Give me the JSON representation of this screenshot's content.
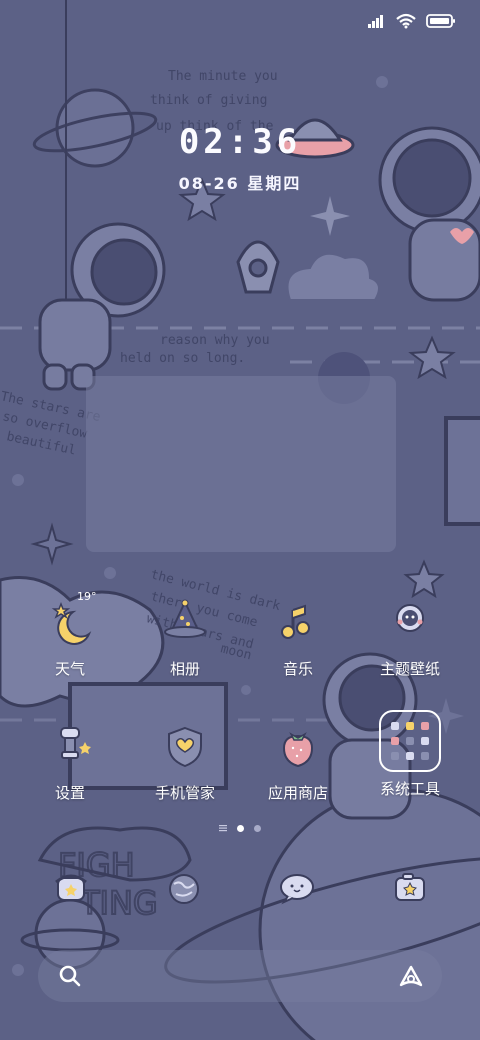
{
  "status_bar": {
    "icons": [
      "signal-icon",
      "wifi-icon",
      "battery-icon"
    ]
  },
  "clock": {
    "time": "02:36",
    "date": "08-26 星期四"
  },
  "wallpaper_text": {
    "line1": "The minute you",
    "line2": "think of giving",
    "line3": "up think of the",
    "line4": "reason why you",
    "line5": "held on so long.",
    "line6": "The stars are",
    "line7": "so overflow",
    "line8": "beautiful",
    "line9": "the world is dark",
    "line10": "there you come",
    "line11": "with stars and",
    "line12": "moon",
    "line13": "FIGH",
    "line14": "TING"
  },
  "apps": {
    "row1": [
      {
        "label": "天气",
        "icon": "weather-moon-icon",
        "temp": "19°"
      },
      {
        "label": "相册",
        "icon": "gallery-wizard-hat-icon"
      },
      {
        "label": "音乐",
        "icon": "music-moon-icon"
      },
      {
        "label": "主题壁纸",
        "icon": "themes-astronaut-icon"
      }
    ],
    "row2": [
      {
        "label": "设置",
        "icon": "settings-lamp-icon"
      },
      {
        "label": "手机管家",
        "icon": "security-shield-icon"
      },
      {
        "label": "应用商店",
        "icon": "app-store-strawberry-icon"
      },
      {
        "label": "系统工具",
        "icon": "system-tools-folder-icon"
      }
    ]
  },
  "dock": [
    {
      "name": "phone",
      "icon": "phone-icon"
    },
    {
      "name": "browser",
      "icon": "globe-icon"
    },
    {
      "name": "messages",
      "icon": "chat-bubble-icon"
    },
    {
      "name": "camera",
      "icon": "camera-icon"
    }
  ],
  "page_indicator": {
    "pages": 2,
    "current": 1
  },
  "search": {
    "icon": "search-icon",
    "assistant_icon": "assistant-icon"
  },
  "colors": {
    "background": "#5c6186",
    "line_art": "#3a3d5c",
    "accent_yellow": "#f6d26a",
    "accent_pink": "#e8a0a8"
  }
}
